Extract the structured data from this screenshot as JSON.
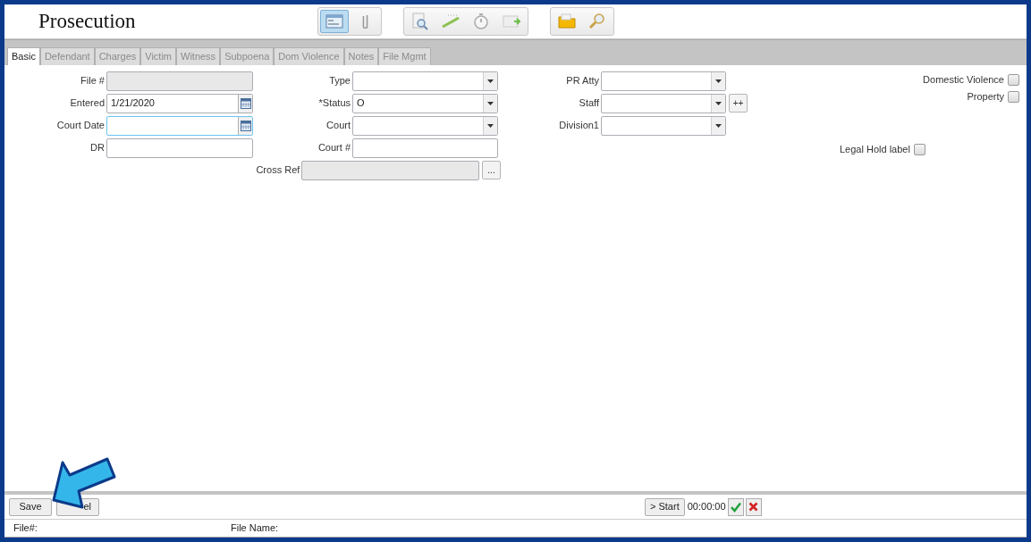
{
  "window": {
    "title": "Prosecution"
  },
  "toolbar_groups": [
    {
      "buttons": [
        {
          "kind": "window",
          "selected": true
        },
        {
          "kind": "paperclip",
          "selected": false
        }
      ]
    },
    {
      "buttons": [
        {
          "kind": "doc-search",
          "selected": false
        },
        {
          "kind": "ruler",
          "selected": false
        },
        {
          "kind": "stopwatch",
          "selected": false
        },
        {
          "kind": "mail",
          "selected": false
        }
      ]
    },
    {
      "buttons": [
        {
          "kind": "folder",
          "selected": false
        },
        {
          "kind": "magnifier",
          "selected": false
        }
      ]
    }
  ],
  "tabs": [
    {
      "label": "Basic",
      "selected": true
    },
    {
      "label": "Defendant",
      "selected": false
    },
    {
      "label": "Charges",
      "selected": false
    },
    {
      "label": "Victim",
      "selected": false
    },
    {
      "label": "Witness",
      "selected": false
    },
    {
      "label": "Subpoena",
      "selected": false
    },
    {
      "label": "Dom Violence",
      "selected": false
    },
    {
      "label": "Notes",
      "selected": false
    },
    {
      "label": "File Mgmt",
      "selected": false
    }
  ],
  "left_fields": [
    {
      "label": "File #",
      "kind": "readonly",
      "focused": false
    },
    {
      "label": "Entered",
      "kind": "date",
      "value": "1/21/2020",
      "focused": false
    },
    {
      "label": "Court Date",
      "kind": "date",
      "focused": true
    },
    {
      "label": "DR",
      "kind": "text",
      "focused": false
    }
  ],
  "middle_fields": [
    {
      "label": "Type",
      "kind": "select",
      "focused": false
    },
    {
      "label": "*Status",
      "kind": "select",
      "value": "O",
      "focused": false
    },
    {
      "label": "Court",
      "kind": "select",
      "focused": false
    },
    {
      "label": "Court #",
      "kind": "text",
      "focused": false
    },
    {
      "label": "Cross Ref",
      "kind": "lookup",
      "button": "...",
      "focused": false
    }
  ],
  "right_fields": [
    {
      "label": "PR Atty",
      "kind": "select",
      "focused": false
    },
    {
      "label": "Staff",
      "kind": "select",
      "button": "++",
      "focused": false
    },
    {
      "label": "Division1",
      "kind": "select",
      "focused": false
    }
  ],
  "checkboxes": [
    {
      "label": "Domestic Violence",
      "checked": false
    },
    {
      "label": "Property",
      "checked": false
    },
    {
      "label": "Legal Hold label",
      "checked": false
    }
  ],
  "actions": [
    {
      "label": "Save"
    },
    {
      "label": "el"
    }
  ],
  "timer": {
    "start_label": "> Start",
    "time": "00:00:00"
  },
  "status_bar": [
    {
      "label": "File#:"
    },
    {
      "label": "File Name:"
    }
  ]
}
